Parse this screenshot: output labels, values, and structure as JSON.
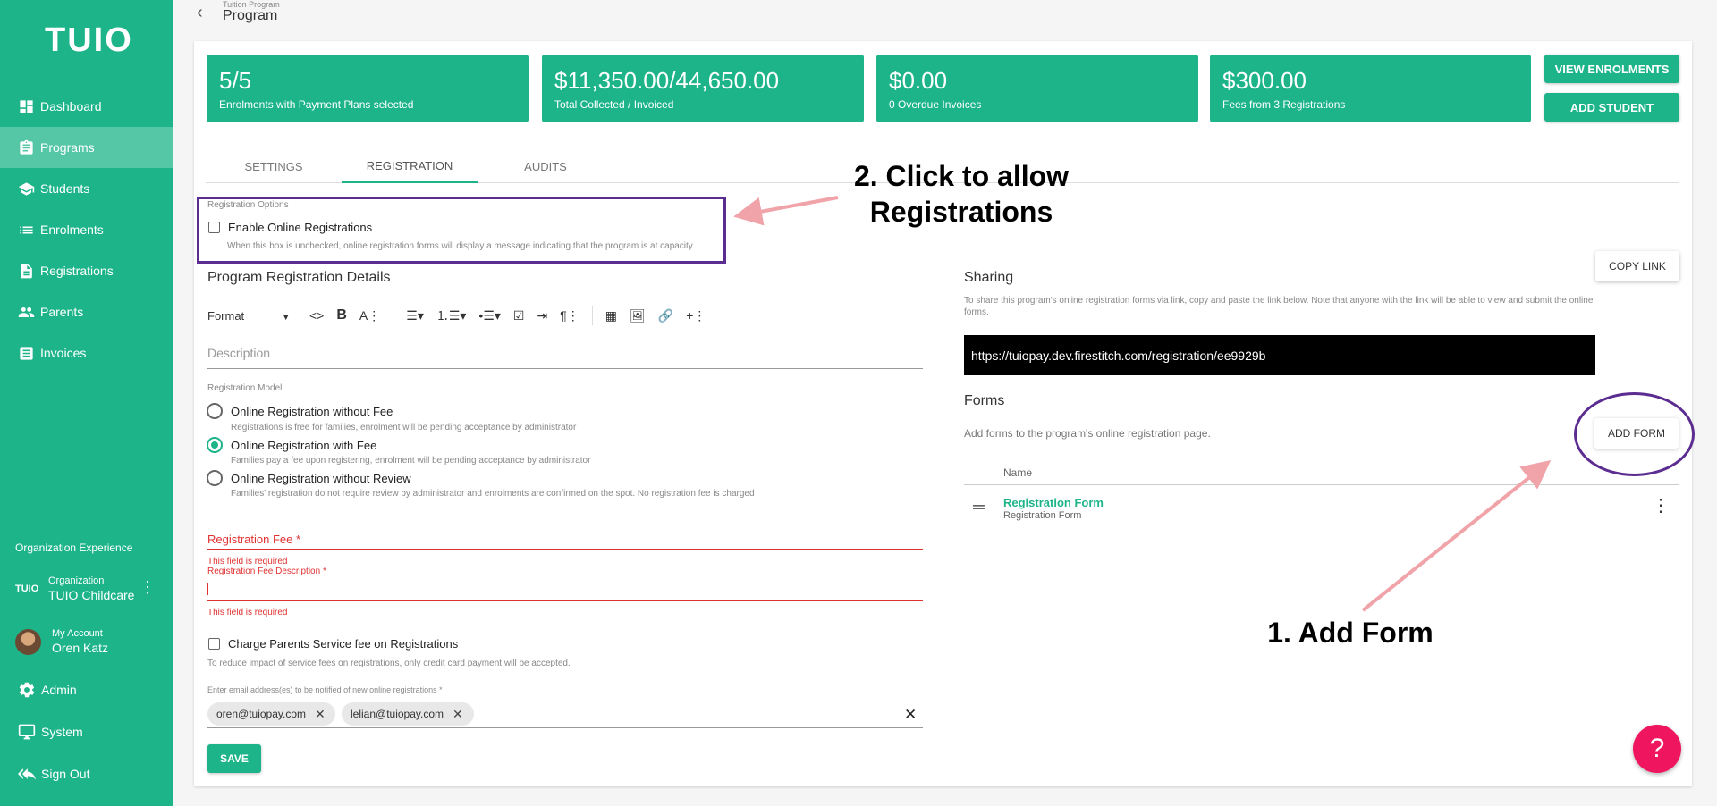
{
  "sidebar": {
    "logo": "TUIO",
    "nav": [
      {
        "label": "Dashboard",
        "icon": "dashboard-icon"
      },
      {
        "label": "Programs",
        "icon": "clipboard-icon"
      },
      {
        "label": "Students",
        "icon": "graduation-cap-icon"
      },
      {
        "label": "Enrolments",
        "icon": "list-icon"
      },
      {
        "label": "Registrations",
        "icon": "document-icon"
      },
      {
        "label": "Parents",
        "icon": "people-icon"
      },
      {
        "label": "Invoices",
        "icon": "invoice-icon"
      }
    ],
    "active_nav": "Programs",
    "org_heading": "Organization Experience",
    "organization": {
      "mini_logo": "TUIO",
      "label": "Organization",
      "name": "TUIO Childcare"
    },
    "account": {
      "label": "My Account",
      "name": "Oren Katz"
    },
    "admin": "Admin",
    "system": "System",
    "signout": "Sign Out"
  },
  "header": {
    "breadcrumb": "Tuition Program",
    "title": "Program"
  },
  "stats": [
    {
      "value": "5/5",
      "label": "Enrolments with Payment Plans selected"
    },
    {
      "value": "$11,350.00/44,650.00",
      "label": "Total Collected / Invoiced"
    },
    {
      "value": "$0.00",
      "label": "0 Overdue Invoices"
    },
    {
      "value": "$300.00",
      "label": "Fees from 3 Registrations"
    }
  ],
  "actions": {
    "view_enrolments": "VIEW ENROLMENTS",
    "add_student": "ADD STUDENT"
  },
  "tabs": [
    "SETTINGS",
    "REGISTRATION",
    "AUDITS"
  ],
  "active_tab": "REGISTRATION",
  "registration_options": {
    "heading": "Registration Options",
    "enable_label": "Enable Online Registrations",
    "enable_checked": false,
    "enable_hint": "When this box is unchecked, online registration forms will display a message indicating that the program is at capacity"
  },
  "details": {
    "title": "Program Registration Details",
    "format_select": "Format",
    "description_placeholder": "Description",
    "model_heading": "Registration Model",
    "models": [
      {
        "label": "Online Registration without Fee",
        "hint": "Registrations is free for families, enrolment will be pending acceptance by administrator",
        "selected": false
      },
      {
        "label": "Online Registration with Fee",
        "hint": "Families pay a fee upon registering, enrolment will be pending acceptance by administrator",
        "selected": true
      },
      {
        "label": "Online Registration without Review",
        "hint": "Families' registration do not require review by administrator and enrolments are confirmed on the spot. No registration fee is charged",
        "selected": false
      }
    ],
    "fee_label": "Registration Fee *",
    "fee_error": "This field is required",
    "fee_desc_label": "Registration Fee Description *",
    "fee_desc_error": "This field is required",
    "service_fee_label": "Charge Parents Service fee on Registrations",
    "service_fee_hint": "To reduce impact of service fees on registrations, only credit card payment will be accepted.",
    "email_label": "Enter email address(es) to be notified of new online registrations *",
    "emails": [
      "oren@tuiopay.com",
      "lelian@tuiopay.com"
    ],
    "save": "SAVE"
  },
  "sharing": {
    "title": "Sharing",
    "copy_link": "COPY LINK",
    "hint": "To share this program's online registration forms via link, copy and paste the link below. Note that anyone with the link will be able to view and submit the online forms.",
    "link": "https://tuiopay.dev.firestitch.com/registration/ee9929b"
  },
  "forms": {
    "title": "Forms",
    "hint": "Add forms to the program's online registration page.",
    "add_form": "ADD FORM",
    "col_name": "Name",
    "rows": [
      {
        "name": "Registration Form",
        "sub": "Registration Form"
      }
    ]
  },
  "annotations": {
    "step2_line1": "2. Click to allow",
    "step2_line2": "Registrations",
    "step1": "1. Add Form",
    "color_highlight": "#5c2d91",
    "color_arrow": "#f0a3a8"
  },
  "help": "?",
  "colors": {
    "brand": "#1db48a",
    "error": "#e03131",
    "help": "#f0155f"
  }
}
